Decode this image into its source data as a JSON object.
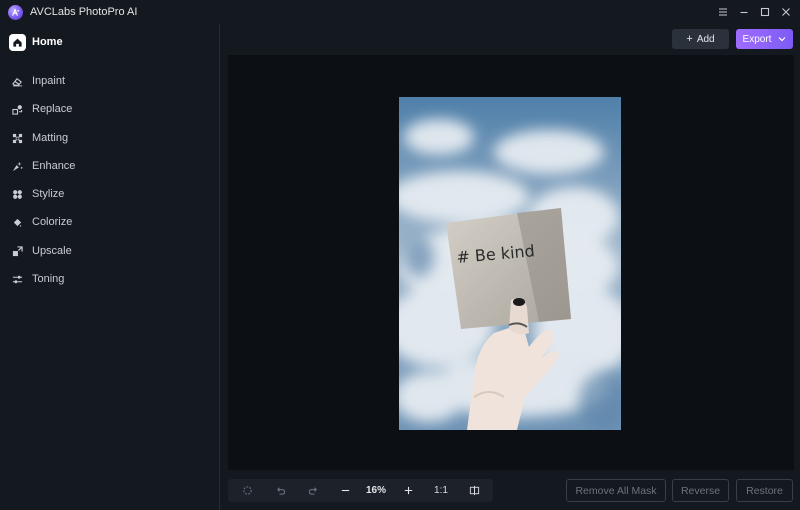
{
  "app": {
    "title": "AVCLabs PhotoPro AI",
    "logo_icon": "avclabs-logo-icon",
    "accent": "#8b62f7"
  },
  "window_controls": [
    {
      "name": "menu-icon"
    },
    {
      "name": "minimize-icon"
    },
    {
      "name": "maximize-icon"
    },
    {
      "name": "close-icon"
    }
  ],
  "sidebar": {
    "home": {
      "label": "Home",
      "icon": "home-icon"
    },
    "items": [
      {
        "label": "Inpaint",
        "icon": "eraser-icon"
      },
      {
        "label": "Replace",
        "icon": "replace-icon"
      },
      {
        "label": "Matting",
        "icon": "matting-icon"
      },
      {
        "label": "Enhance",
        "icon": "enhance-icon"
      },
      {
        "label": "Stylize",
        "icon": "stylize-icon"
      },
      {
        "label": "Colorize",
        "icon": "colorize-icon"
      },
      {
        "label": "Upscale",
        "icon": "upscale-icon"
      },
      {
        "label": "Toning",
        "icon": "toning-icon"
      }
    ]
  },
  "toolbar": {
    "add_label": "Add",
    "export_label": "Export"
  },
  "canvas": {
    "image_icon": "photo-preview",
    "note_text": "# Be kind"
  },
  "zoom": {
    "level": "16%",
    "actual_size": "1:1"
  },
  "actions": {
    "remove_all_mask": "Remove All Mask",
    "reverse": "Reverse",
    "restore": "Restore"
  }
}
